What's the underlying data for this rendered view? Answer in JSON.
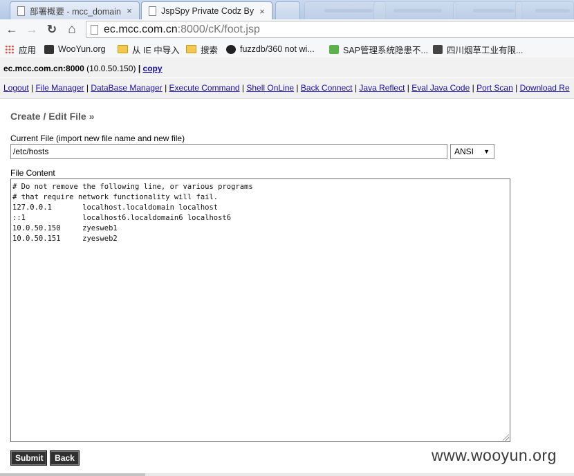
{
  "browser": {
    "tabs": [
      {
        "title": "部署概要 - mcc_domain",
        "close": "×",
        "active": false
      },
      {
        "title": "JspSpy Private Codz By",
        "close": "×",
        "active": true
      }
    ],
    "nav": {
      "back": "←",
      "forward": "→",
      "reload": "↻",
      "home": "⌂"
    },
    "url": {
      "host": "ec.mcc.com.cn",
      "rest": ":8000/cK/foot.jsp"
    },
    "bookmarks": [
      {
        "label": "应用",
        "icon": "apps-icon"
      },
      {
        "label": "WooYun.org",
        "icon": "wooyun-icon"
      },
      {
        "label": "从 IE 中导入",
        "icon": "folder-icon"
      },
      {
        "label": "搜索",
        "icon": "folder-icon"
      },
      {
        "label": "fuzzdb/360 not wi...",
        "icon": "github-icon"
      },
      {
        "label": "SAP管理系统隐患不...",
        "icon": "sap-icon"
      },
      {
        "label": "四川烟草工业有限...",
        "icon": "site-icon"
      }
    ]
  },
  "host": {
    "name": "ec.mcc.com.cn:8000",
    "ip": "(10.0.50.150)",
    "separator": "|",
    "copy": "copy"
  },
  "menu": [
    "Logout",
    "File Manager",
    "DataBase Manager",
    "Execute Command",
    "Shell OnLine",
    "Back Connect",
    "Java Reflect",
    "Eval Java Code",
    "Port Scan",
    "Download Re"
  ],
  "editor": {
    "title": "Create / Edit File »",
    "current_file_label": "Current File (import new file name and new file)",
    "current_file_value": "/etc/hosts",
    "encoding": "ANSI",
    "content_label": "File Content",
    "content": "# Do not remove the following line, or various programs\n# that require network functionality will fail.\n127.0.0.1       localhost.localdomain localhost\n::1             localhost6.localdomain6 localhost6\n10.0.50.150     zyesweb1\n10.0.50.151     zyesweb2",
    "submit": "Submit",
    "back": "Back"
  },
  "watermark": "www.wooyun.org"
}
